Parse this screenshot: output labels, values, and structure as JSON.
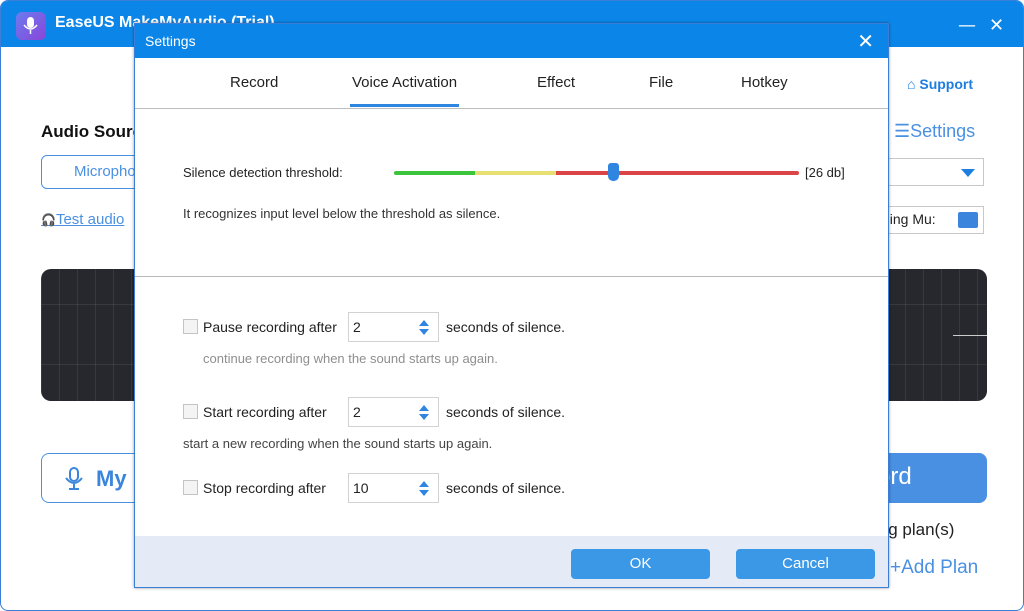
{
  "app": {
    "title": "EaseUS MakeMyAudio (Trial)",
    "minimize_label": "—",
    "close_label": "✕",
    "support_label": "Support",
    "support_icon": "home-icon",
    "settings_label": "Settings",
    "settings_icon": "sliders-icon",
    "audio_source_title": "Audio Source",
    "mic_button_label": "Microphone",
    "test_audio_label": "Test audio",
    "test_audio_icon": "headphones-icon",
    "output_path_text": "ding Mu:",
    "my_button_label": "My",
    "record_button_label": "ord",
    "plans_text": "ing plan(s)",
    "add_plan_label": "+Add Plan"
  },
  "dialog": {
    "title": "Settings",
    "close_label": "✕",
    "tabs": [
      {
        "label": "Record",
        "active": false
      },
      {
        "label": "Voice Activation",
        "active": true
      },
      {
        "label": "Effect",
        "active": false
      },
      {
        "label": "File",
        "active": false
      },
      {
        "label": "Hotkey",
        "active": false
      }
    ],
    "threshold": {
      "label": "Silence detection threshold:",
      "value_text": "[26 db]",
      "slider_fraction": 0.54,
      "zones": [
        {
          "color": "#3cc43c",
          "end_fraction": 0.2
        },
        {
          "color": "#e8df72",
          "end_fraction": 0.4
        },
        {
          "color": "#dc4548",
          "end_fraction": 1.0
        }
      ],
      "thumb_color": "#2f86e0",
      "description": "It recognizes input level below the threshold as silence."
    },
    "options": [
      {
        "label": "Pause recording after",
        "value": "2",
        "suffix": "seconds of silence.",
        "checked": false,
        "description": "continue recording when the sound starts up again.",
        "description_muted": true
      },
      {
        "label": "Start recording after",
        "value": "2",
        "suffix": "seconds of silence.",
        "checked": false,
        "description": "start a new recording when the sound starts up again.",
        "description_muted": false
      },
      {
        "label": "Stop recording after",
        "value": "10",
        "suffix": "seconds of silence.",
        "checked": false
      }
    ],
    "ok_label": "OK",
    "cancel_label": "Cancel"
  }
}
